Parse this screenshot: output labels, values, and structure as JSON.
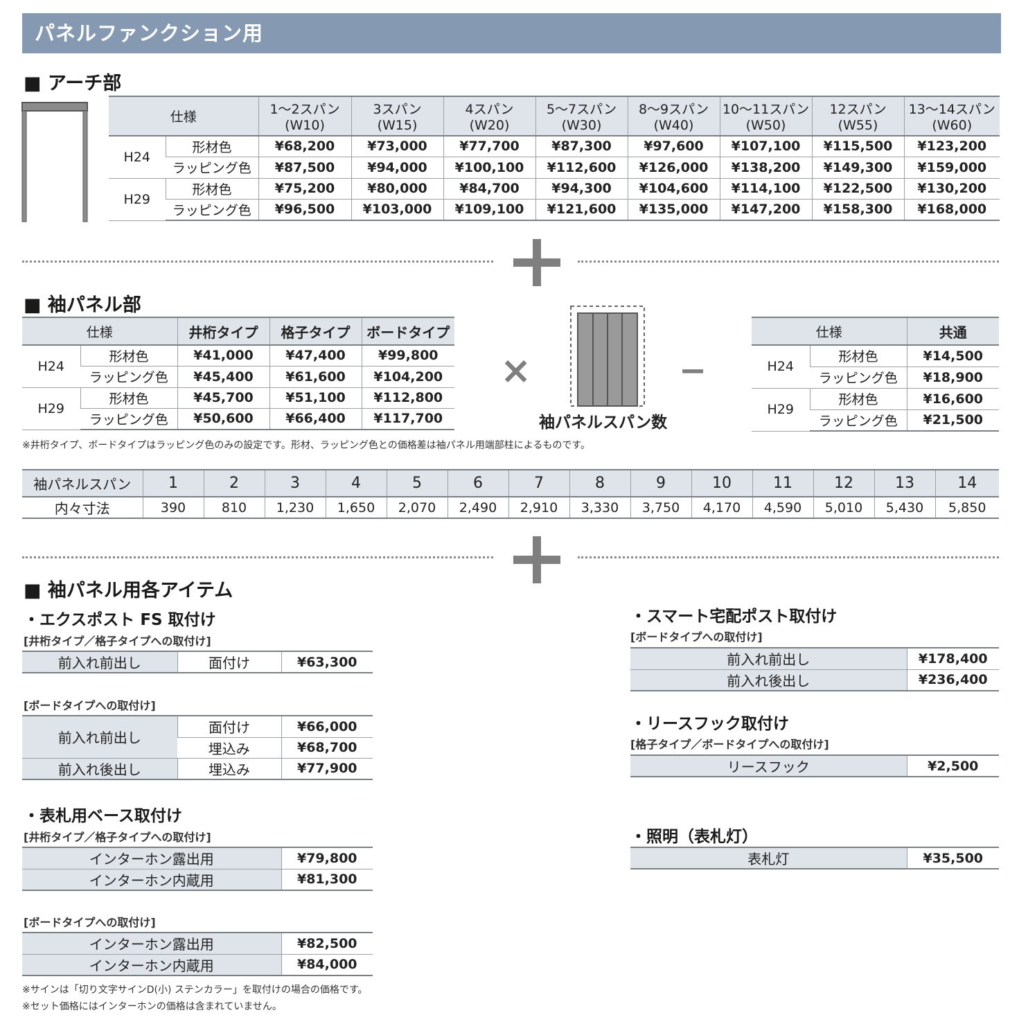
{
  "banner_title": "パネルファンクション用",
  "arch": {
    "title": "■ アーチ部",
    "spec_header": "仕様",
    "spans": [
      {
        "l1": "1〜2スパン",
        "l2": "(W10)"
      },
      {
        "l1": "3スパン",
        "l2": "(W15)"
      },
      {
        "l1": "4スパン",
        "l2": "(W20)"
      },
      {
        "l1": "5〜7スパン",
        "l2": "(W30)"
      },
      {
        "l1": "8〜9スパン",
        "l2": "(W40)"
      },
      {
        "l1": "10〜11スパン",
        "l2": "(W50)"
      },
      {
        "l1": "12スパン",
        "l2": "(W55)"
      },
      {
        "l1": "13〜14スパン",
        "l2": "(W60)"
      }
    ],
    "rows": [
      {
        "h": "H24",
        "c": "形材色",
        "v": [
          "¥68,200",
          "¥73,000",
          "¥77,700",
          "¥87,300",
          "¥97,600",
          "¥107,100",
          "¥115,500",
          "¥123,200"
        ]
      },
      {
        "h": "H24",
        "c": "ラッピング色",
        "v": [
          "¥87,500",
          "¥94,000",
          "¥100,100",
          "¥112,600",
          "¥126,000",
          "¥138,200",
          "¥149,300",
          "¥159,000"
        ]
      },
      {
        "h": "H29",
        "c": "形材色",
        "v": [
          "¥75,200",
          "¥80,000",
          "¥84,700",
          "¥94,300",
          "¥104,600",
          "¥114,100",
          "¥122,500",
          "¥130,200"
        ]
      },
      {
        "h": "H29",
        "c": "ラッピング色",
        "v": [
          "¥96,500",
          "¥103,000",
          "¥109,100",
          "¥121,600",
          "¥135,000",
          "¥147,200",
          "¥158,300",
          "¥168,000"
        ]
      }
    ]
  },
  "sleeve": {
    "title": "■ 袖パネル部",
    "headers": [
      "仕様",
      "井桁タイプ",
      "格子タイプ",
      "ボードタイプ"
    ],
    "rows": [
      {
        "h": "H24",
        "c": "形材色",
        "v": [
          "¥41,000",
          "¥47,400",
          "¥99,800"
        ]
      },
      {
        "h": "H24",
        "c": "ラッピング色",
        "v": [
          "¥45,400",
          "¥61,600",
          "¥104,200"
        ]
      },
      {
        "h": "H29",
        "c": "形材色",
        "v": [
          "¥45,700",
          "¥51,100",
          "¥112,800"
        ]
      },
      {
        "h": "H29",
        "c": "ラッピング色",
        "v": [
          "¥50,600",
          "¥66,400",
          "¥117,700"
        ]
      }
    ],
    "times": "×",
    "minus": "−",
    "diagram_label": "袖パネルスパン数",
    "common_headers": [
      "仕様",
      "共通"
    ],
    "common_rows": [
      {
        "h": "H24",
        "c": "形材色",
        "v": "¥14,500"
      },
      {
        "h": "H24",
        "c": "ラッピング色",
        "v": "¥18,900"
      },
      {
        "h": "H29",
        "c": "形材色",
        "v": "¥16,600"
      },
      {
        "h": "H29",
        "c": "ラッピング色",
        "v": "¥21,500"
      }
    ],
    "note": "※井桁タイプ、ボードタイプはラッピング色のみの設定です。形材、ラッピング色との価格差は袖パネル用端部柱によるものです。"
  },
  "span_table": {
    "header": "袖パネルスパン",
    "spans": [
      "1",
      "2",
      "3",
      "4",
      "5",
      "6",
      "7",
      "8",
      "9",
      "10",
      "11",
      "12",
      "13",
      "14"
    ],
    "row_label": "内々寸法",
    "dims": [
      "390",
      "810",
      "1,230",
      "1,650",
      "2,070",
      "2,490",
      "2,910",
      "3,330",
      "3,750",
      "4,170",
      "4,590",
      "5,010",
      "5,430",
      "5,850"
    ]
  },
  "items": {
    "title": "■ 袖パネル用各アイテム",
    "expost": {
      "title": "・エクスポスト FS 取付け",
      "cap1": "[井桁タイプ／格子タイプへの取付け]",
      "t1": [
        {
          "a": "前入れ前出し",
          "b": "面付け",
          "v": "¥63,300"
        }
      ],
      "cap2": "[ボードタイプへの取付け]",
      "t2_a1": "前入れ前出し",
      "t2_b1": "面付け",
      "t2_v1": "¥66,000",
      "t2_b2": "埋込み",
      "t2_v2": "¥68,700",
      "t2_a3": "前入れ後出し",
      "t2_b3": "埋込み",
      "t2_v3": "¥77,900"
    },
    "nameplate": {
      "title": "・表札用ベース取付け",
      "cap1": "[井桁タイプ／格子タイプへの取付け]",
      "t1": [
        {
          "a": "インターホン露出用",
          "v": "¥79,800"
        },
        {
          "a": "インターホン内蔵用",
          "v": "¥81,300"
        }
      ],
      "cap2": "[ボードタイプへの取付け]",
      "t2": [
        {
          "a": "インターホン露出用",
          "v": "¥82,500"
        },
        {
          "a": "インターホン内蔵用",
          "v": "¥84,000"
        }
      ],
      "note1": "※サインは「切り文字サインD(小) ステンカラー」を取付けの場合の価格です。",
      "note2": "※セット価格にはインターホンの価格は含まれていません。"
    },
    "smartpost": {
      "title": "・スマート宅配ポスト取付け",
      "cap": "[ボードタイプへの取付け]",
      "t": [
        {
          "a": "前入れ前出し",
          "v": "¥178,400"
        },
        {
          "a": "前入れ後出し",
          "v": "¥236,400"
        }
      ]
    },
    "wreath": {
      "title": "・リースフック取付け",
      "cap": "[格子タイプ／ボードタイプへの取付け]",
      "t": [
        {
          "a": "リースフック",
          "v": "¥2,500"
        }
      ]
    },
    "light": {
      "title": "・照明（表札灯）",
      "t": [
        {
          "a": "表札灯",
          "v": "¥35,500"
        }
      ]
    }
  }
}
